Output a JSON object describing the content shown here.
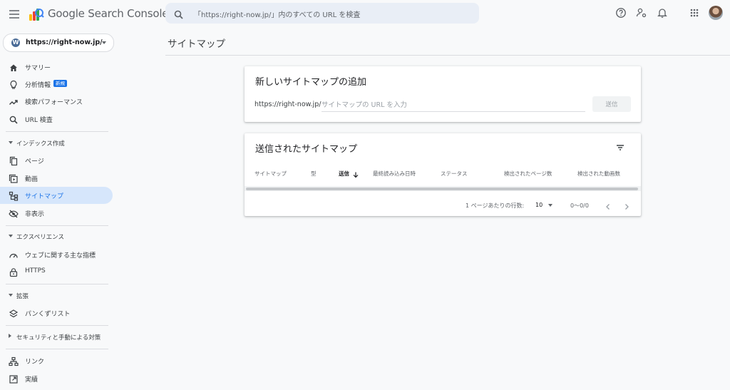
{
  "app": {
    "title": "Google Search Console"
  },
  "search": {
    "placeholder": "「https://right-now.jp/」内のすべての URL を検査"
  },
  "header_icons": [
    "menu-icon",
    "help-icon",
    "account-settings-icon",
    "bell-icon",
    "apps-grid-icon",
    "avatar"
  ],
  "property": {
    "name": "https://right-now.jp/",
    "icon": "wordpress-icon"
  },
  "sidebar": {
    "items": [
      {
        "label": "サマリー",
        "icon": "home-icon"
      },
      {
        "label": "分析情報",
        "icon": "lightbulb-icon",
        "badge": "新規"
      },
      {
        "label": "検索パフォーマンス",
        "icon": "trending-up-icon"
      },
      {
        "label": "URL 検査",
        "icon": "search-icon"
      }
    ],
    "sections": [
      {
        "label": "インデックス作成",
        "expanded": true,
        "items": [
          {
            "label": "ページ",
            "icon": "pages-icon"
          },
          {
            "label": "動画",
            "icon": "video-icon"
          },
          {
            "label": "サイトマップ",
            "icon": "sitemap-icon",
            "active": true
          },
          {
            "label": "非表示",
            "icon": "eye-off-icon"
          }
        ]
      },
      {
        "label": "エクスペリエンス",
        "expanded": true,
        "items": [
          {
            "label": "ウェブに関する主な指標",
            "icon": "speedometer-icon"
          },
          {
            "label": "HTTPS",
            "icon": "lock-icon"
          }
        ]
      },
      {
        "label": "拡張",
        "expanded": true,
        "items": [
          {
            "label": "パンくずリスト",
            "icon": "layers-icon"
          }
        ]
      },
      {
        "label": "セキュリティと手動による対策",
        "expanded": false,
        "items": []
      }
    ],
    "bottom_items": [
      {
        "label": "リンク",
        "icon": "links-icon"
      },
      {
        "label": "実績",
        "icon": "external-link-icon"
      }
    ]
  },
  "page": {
    "title": "サイトマップ"
  },
  "add_card": {
    "title": "新しいサイトマップの追加",
    "prefix": "https://right-now.jp/",
    "input_placeholder": "サイトマップの URL を入力",
    "submit_label": "送信"
  },
  "submitted_card": {
    "title": "送信されたサイトマップ",
    "columns": [
      "サイトマップ",
      "型",
      "送信",
      "最終読み込み日時",
      "ステータス",
      "検出されたページ数",
      "検出された動画数"
    ],
    "sorted_column": "送信",
    "rows": [],
    "pagination": {
      "rows_per_page_label": "1 ページあたりの行数:",
      "rows_per_page": "10",
      "range": "0〜0/0"
    }
  },
  "colors": {
    "accent": "#1a73e8",
    "active_bg": "#d6e6fb",
    "background": "#f8f9fa"
  }
}
